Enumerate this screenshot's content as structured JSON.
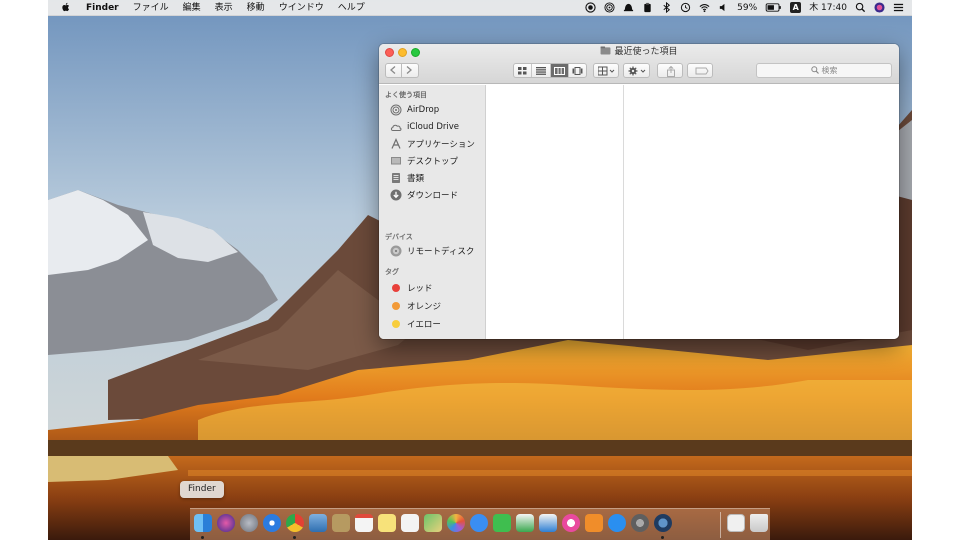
{
  "menubar": {
    "app_name": "Finder",
    "items": [
      "ファイル",
      "編集",
      "表示",
      "移動",
      "ウインドウ",
      "ヘルプ"
    ],
    "battery": "59%",
    "input_source": "A",
    "clock": "木 17:40"
  },
  "window": {
    "title": "最近使った項目",
    "search_placeholder": "検索",
    "view_mode": "column"
  },
  "sidebar": {
    "favorites_header": "よく使う項目",
    "favorites": [
      {
        "label": "AirDrop",
        "icon": "airdrop-icon"
      },
      {
        "label": "iCloud Drive",
        "icon": "cloud-icon"
      },
      {
        "label": "アプリケーション",
        "icon": "applications-icon"
      },
      {
        "label": "デスクトップ",
        "icon": "desktop-icon"
      },
      {
        "label": "書類",
        "icon": "documents-icon"
      },
      {
        "label": "ダウンロード",
        "icon": "download-icon"
      }
    ],
    "devices_header": "デバイス",
    "devices": [
      {
        "label": "リモートディスク",
        "icon": "remote-disc-icon"
      }
    ],
    "tags_header": "タグ",
    "tags": [
      {
        "label": "レッド",
        "color": "#e8403a"
      },
      {
        "label": "オレンジ",
        "color": "#f29a38"
      },
      {
        "label": "イエロー",
        "color": "#f7cd3c"
      }
    ]
  },
  "dock": {
    "tooltip": "Finder",
    "apps": [
      {
        "name": "finder-icon",
        "color": "#2a8fe8"
      },
      {
        "name": "siri-icon",
        "color": "#5a3bd6"
      },
      {
        "name": "launchpad-icon",
        "color": "#8b8f99"
      },
      {
        "name": "safari-icon",
        "color": "#2b7be0"
      },
      {
        "name": "chrome-icon",
        "color": "#e34133"
      },
      {
        "name": "photo-preview-icon",
        "color": "#2f6fb0"
      },
      {
        "name": "notefile-icon",
        "color": "#b69a61"
      },
      {
        "name": "calendar-icon",
        "color": "#f4f4f4"
      },
      {
        "name": "notes-icon",
        "color": "#f7e27a"
      },
      {
        "name": "reminders-icon",
        "color": "#f3f3f3"
      },
      {
        "name": "maps-icon",
        "color": "#6cc36a"
      },
      {
        "name": "photos-icon",
        "color": "#f2b440"
      },
      {
        "name": "messages-icon",
        "color": "#3a8ef2"
      },
      {
        "name": "facetime-icon",
        "color": "#3fbe4f"
      },
      {
        "name": "numbers-icon",
        "color": "#3aa84f"
      },
      {
        "name": "keynote-icon",
        "color": "#2e7fd3"
      },
      {
        "name": "itunes-icon",
        "color": "#e94a9e"
      },
      {
        "name": "ibooks-icon",
        "color": "#f08d2a"
      },
      {
        "name": "app-store-icon",
        "color": "#2a8ff0"
      },
      {
        "name": "system-preferences-icon",
        "color": "#7a7a7a"
      },
      {
        "name": "quicktime-icon",
        "color": "#1f3b60"
      },
      {
        "name": "document-icon",
        "color": "#f0f0f0"
      },
      {
        "name": "trash-icon",
        "color": "#d9d9d9"
      }
    ]
  }
}
